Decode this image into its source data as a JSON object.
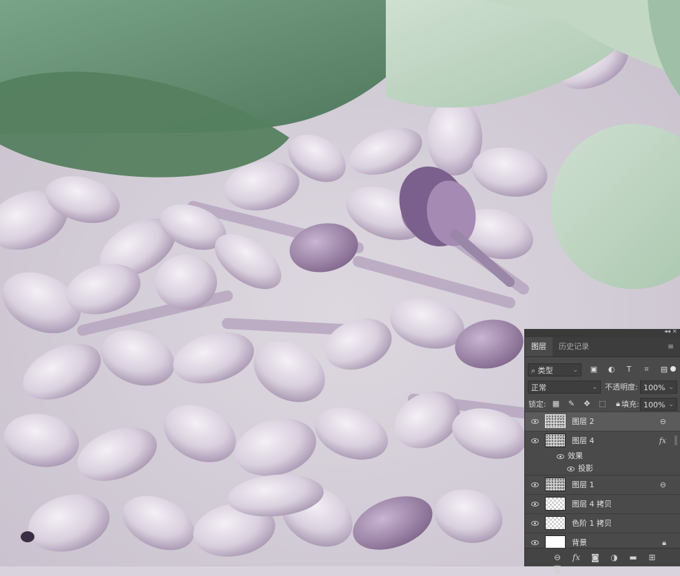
{
  "panel": {
    "tabs": [
      "图层",
      "历史记录"
    ],
    "filter_label": "类型",
    "blend_mode": "正常",
    "opacity_label": "不透明度:",
    "opacity_value": "100%",
    "lock_label": "锁定:",
    "fill_label": "填充:",
    "fill_value": "100%",
    "layers": [
      {
        "name": "图层 2"
      },
      {
        "name": "图层 4"
      },
      {
        "name": "效果"
      },
      {
        "name": "投影"
      },
      {
        "name": "图层 1"
      },
      {
        "name": "图层 4 拷贝"
      },
      {
        "name": "色阶 1 拷贝"
      },
      {
        "name": "背景"
      }
    ]
  },
  "colors": {
    "leaf_dark": "#5f8a6b",
    "leaf_light": "#b9d1bd",
    "petal_light": "#e9e4ec",
    "petal_purple": "#a692b0",
    "panel_bg": "#4a4a4a"
  }
}
